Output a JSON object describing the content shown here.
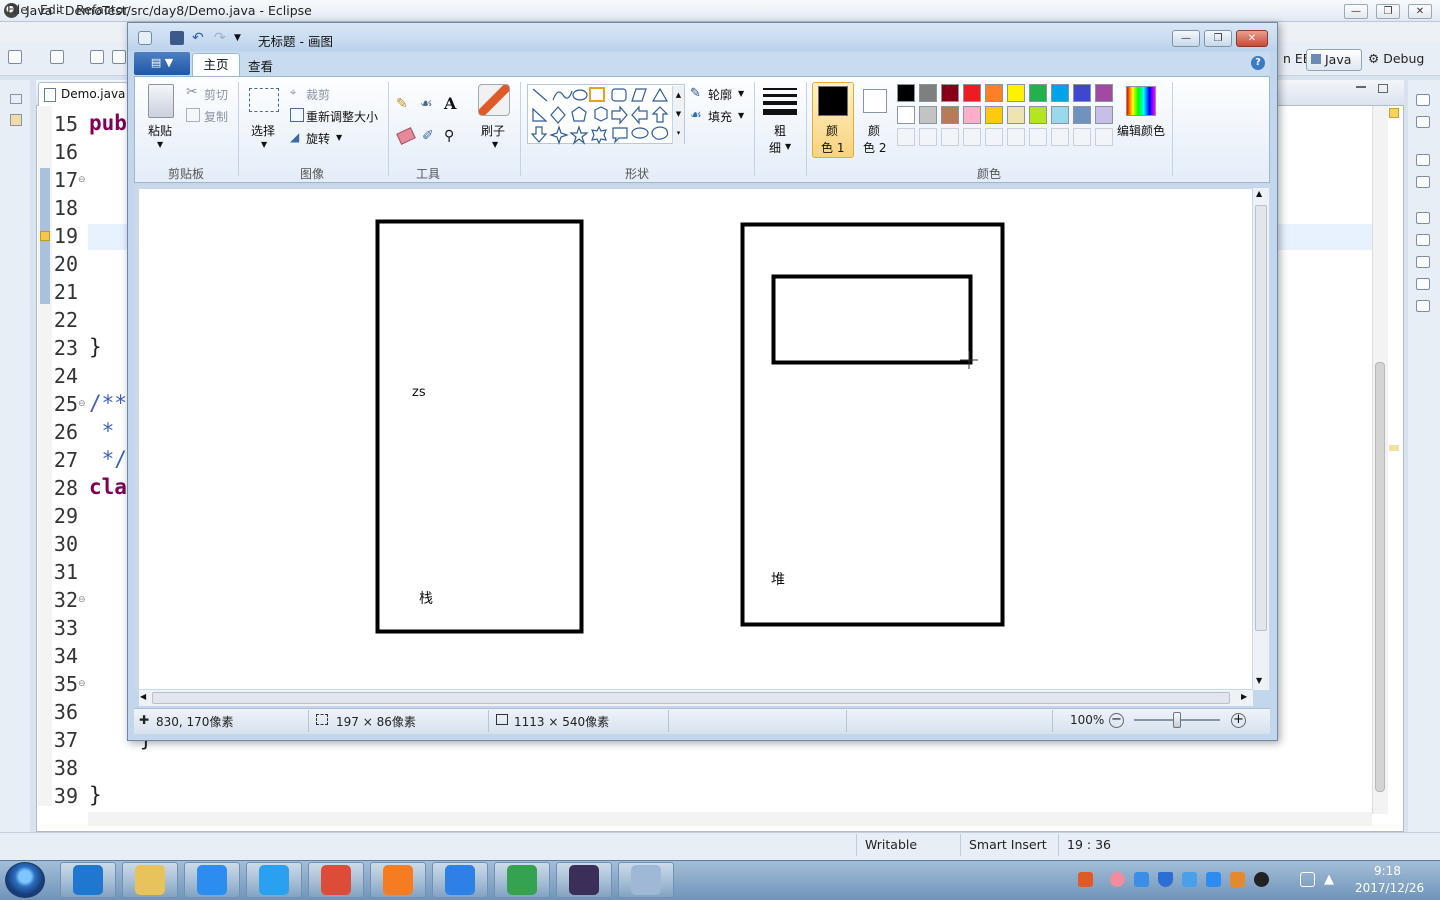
{
  "eclipse": {
    "title": "Java - DemoTest/src/day8/Demo.java - Eclipse",
    "menu": [
      "File",
      "Edit",
      "Refactor"
    ],
    "perspectives": {
      "java_ee": "n EE",
      "java": "Java",
      "debug": "Debug"
    },
    "editor_tab": "Demo.java",
    "code_lines": [
      {
        "num": "15",
        "text": "pub",
        "kind": "kw"
      },
      {
        "num": "16",
        "text": "",
        "kind": ""
      },
      {
        "num": "17",
        "text": "",
        "kind": ""
      },
      {
        "num": "18",
        "text": "",
        "kind": ""
      },
      {
        "num": "19",
        "text": "",
        "kind": ""
      },
      {
        "num": "20",
        "text": "",
        "kind": ""
      },
      {
        "num": "21",
        "text": "",
        "kind": ""
      },
      {
        "num": "22",
        "text": "",
        "kind": ""
      },
      {
        "num": "23",
        "text": "}",
        "kind": ""
      },
      {
        "num": "24",
        "text": "",
        "kind": ""
      },
      {
        "num": "25",
        "text": "/**",
        "kind": "cm"
      },
      {
        "num": "26",
        "text": " *",
        "kind": "cm"
      },
      {
        "num": "27",
        "text": " */",
        "kind": "cm"
      },
      {
        "num": "28",
        "text": "cla",
        "kind": "kw"
      },
      {
        "num": "29",
        "text": "",
        "kind": ""
      },
      {
        "num": "30",
        "text": "",
        "kind": ""
      },
      {
        "num": "31",
        "text": "",
        "kind": ""
      },
      {
        "num": "32",
        "text": "",
        "kind": ""
      },
      {
        "num": "33",
        "text": "",
        "kind": ""
      },
      {
        "num": "34",
        "text": "",
        "kind": ""
      },
      {
        "num": "35",
        "text": "",
        "kind": ""
      },
      {
        "num": "36",
        "text": "",
        "kind": ""
      },
      {
        "num": "37",
        "text": "    }",
        "kind": ""
      },
      {
        "num": "38",
        "text": "",
        "kind": ""
      },
      {
        "num": "39",
        "text": "}",
        "kind": ""
      }
    ],
    "status": {
      "writable": "Writable",
      "insert_mode": "Smart Insert",
      "position": "19 : 36"
    }
  },
  "paint": {
    "title": "无标题 - 画图",
    "tabs": {
      "home": "主页",
      "view": "查看"
    },
    "clipboard": {
      "paste": "粘贴",
      "cut": "剪切",
      "copy": "复制",
      "label": "剪贴板"
    },
    "image": {
      "select": "选择",
      "crop": "裁剪",
      "resize": "重新调整大小",
      "rotate": "旋转",
      "label": "图像"
    },
    "tools": {
      "label": "工具",
      "text_tool": "A"
    },
    "brushes": {
      "label": "刷子"
    },
    "shapes": {
      "outline": "轮廓",
      "fill": "填充",
      "label": "形状"
    },
    "size": {
      "line1": "粗",
      "line2": "细"
    },
    "color1": {
      "line1": "颜",
      "line2": "色 1"
    },
    "color2": {
      "line1": "颜",
      "line2": "色 2"
    },
    "colors": {
      "label": "颜色",
      "edit": "编辑颜色",
      "row1": [
        "#000000",
        "#7f7f7f",
        "#880015",
        "#ed1c24",
        "#ff7f27",
        "#fff200",
        "#22b14c",
        "#00a2e8",
        "#3f48cc",
        "#a349a4"
      ],
      "row2": [
        "#ffffff",
        "#c3c3c3",
        "#b97a57",
        "#ffaec9",
        "#ffc90e",
        "#efe4b0",
        "#b5e61d",
        "#99d9ea",
        "#7092be",
        "#c8bfe7"
      ]
    },
    "canvas_text": {
      "zs": "zs",
      "stack": "栈",
      "heap": "堆"
    },
    "status": {
      "cursor": "830, 170像素",
      "selection": "197 × 86像素",
      "canvas_size": "1113 × 540像素",
      "zoom": "100%"
    },
    "zoom_level": 1.0
  },
  "taskbar": {
    "apps": [
      {
        "name": "ie-icon",
        "color": "#1f77d0"
      },
      {
        "name": "explorer-icon",
        "color": "#e8c25a"
      },
      {
        "name": "notes-icon",
        "color": "#2d8cf0"
      },
      {
        "name": "baidu-cloud-icon",
        "color": "#2aa1f0"
      },
      {
        "name": "chrome-icon",
        "color": "#dd4b39"
      },
      {
        "name": "wps-presentation-icon",
        "color": "#f57c20"
      },
      {
        "name": "wps-writer-icon",
        "color": "#2d80e6"
      },
      {
        "name": "idea-icon",
        "color": "#34a24f"
      },
      {
        "name": "eclipse-icon",
        "color": "#3b2f5a"
      },
      {
        "name": "paint-icon",
        "color": "#9fb8d6"
      }
    ],
    "time": "9:18",
    "date": "2017/12/26"
  }
}
